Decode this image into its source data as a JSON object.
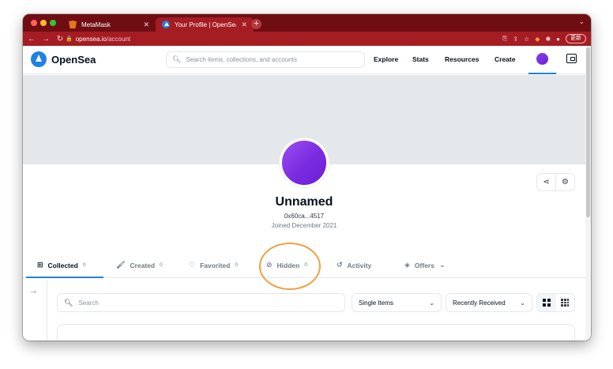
{
  "browser": {
    "tabs": [
      {
        "title": "MetaMask",
        "favicon": "metamask-icon",
        "active": false
      },
      {
        "title": "Your Profile | OpenSea",
        "favicon": "opensea-icon",
        "active": true
      }
    ],
    "address": {
      "domain": "opensea.io",
      "path": "/account"
    },
    "update_label": "更新",
    "theme_color": "#a51c22"
  },
  "header": {
    "brand": "OpenSea",
    "search_placeholder": "Search items, collections, and accounts",
    "nav": {
      "explore": "Explore",
      "stats": "Stats",
      "resources": "Resources",
      "create": "Create"
    },
    "accent": "#2081e2"
  },
  "profile": {
    "name": "Unnamed",
    "address": "0x60ca...4517",
    "joined": "Joined December 2021",
    "avatar_color": "#7a2be0"
  },
  "tabs": [
    {
      "label": "Collected",
      "count": "0",
      "icon": "collection-icon",
      "active": true
    },
    {
      "label": "Created",
      "count": "0",
      "icon": "paintbrush-icon",
      "active": false
    },
    {
      "label": "Favorited",
      "count": "0",
      "icon": "heart-icon",
      "active": false
    },
    {
      "label": "Hidden",
      "count": "0",
      "icon": "eye-off-icon",
      "active": false,
      "highlighted": true
    },
    {
      "label": "Activity",
      "icon": "history-icon",
      "active": false
    },
    {
      "label": "Offers",
      "icon": "tag-icon",
      "active": false,
      "dropdown": true
    }
  ],
  "filters": {
    "search_placeholder": "Search",
    "item_type": "Single Items",
    "sort": "Recently Received",
    "view_mode": "large-grid"
  },
  "highlight_color": "#f0a042"
}
